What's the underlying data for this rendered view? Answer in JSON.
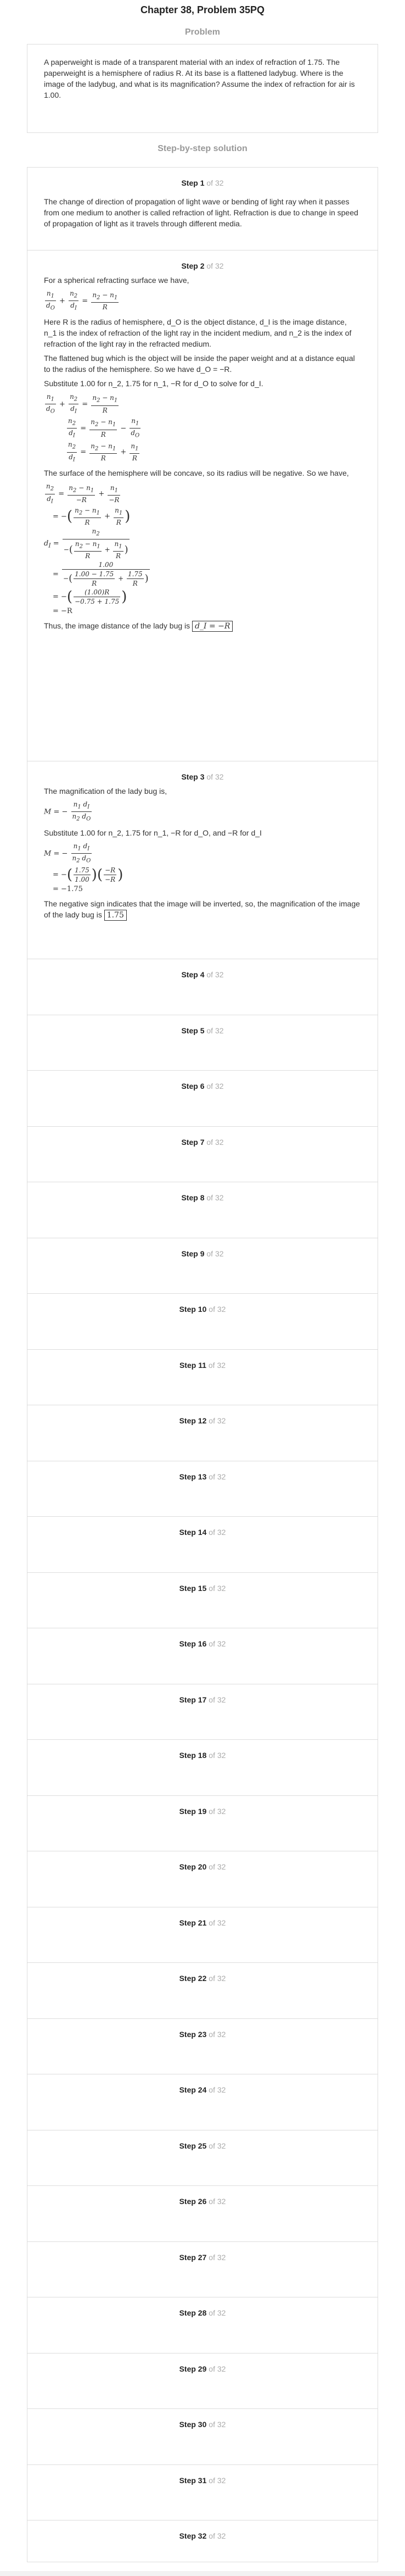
{
  "title": "Chapter 38, Problem 35PQ",
  "problem_heading": "Problem",
  "problem_text": "A paperweight is made of a transparent material with an index of refraction of 1.75. The paperweight is a hemisphere of radius R. At its base is a flattened ladybug. Where is the image of the ladybug, and what is its magnification? Assume the index of refraction for air is 1.00.",
  "solution_heading": "Step-by-step solution",
  "total_steps_label": "of 32",
  "steps": [
    {
      "label": "Step 1"
    },
    {
      "label": "Step 2"
    },
    {
      "label": "Step 3"
    },
    {
      "label": "Step 4"
    },
    {
      "label": "Step 5"
    },
    {
      "label": "Step 6"
    },
    {
      "label": "Step 7"
    },
    {
      "label": "Step 8"
    },
    {
      "label": "Step 9"
    },
    {
      "label": "Step 10"
    },
    {
      "label": "Step 11"
    },
    {
      "label": "Step 12"
    },
    {
      "label": "Step 13"
    },
    {
      "label": "Step 14"
    },
    {
      "label": "Step 15"
    },
    {
      "label": "Step 16"
    },
    {
      "label": "Step 17"
    },
    {
      "label": "Step 18"
    },
    {
      "label": "Step 19"
    },
    {
      "label": "Step 20"
    },
    {
      "label": "Step 21"
    },
    {
      "label": "Step 22"
    },
    {
      "label": "Step 23"
    },
    {
      "label": "Step 24"
    },
    {
      "label": "Step 25"
    },
    {
      "label": "Step 26"
    },
    {
      "label": "Step 27"
    },
    {
      "label": "Step 28"
    },
    {
      "label": "Step 29"
    },
    {
      "label": "Step 30"
    },
    {
      "label": "Step 31"
    },
    {
      "label": "Step 32"
    }
  ],
  "step1": {
    "text": "The change of direction of propagation of light wave or bending of light ray when it passes from one medium to another is called refraction of light. Refraction is due to change in speed of propagation of light as it travels through different media."
  },
  "step2": {
    "intro": "For a spherical refracting surface we have,",
    "here_text": "Here R is the radius of hemisphere, d_O is the object distance, d_I is the image distance, n_1 is the index of refraction of the light ray in the incident medium, and n_2 is the index of refraction of the light ray in the refracted medium.",
    "bug_text": "The flattened bug which is the object will be inside the paper weight and at a distance equal to the radius of the hemisphere. So we have d_O = −R.",
    "substitute_text": "Substitute 1.00 for n_2, 1.75 for n_1, −R for d_O to solve for d_I.",
    "concave_text": "The surface of the hemisphere will be concave, so its radius will be negative. So we have,",
    "result_text": "Thus, the image distance of the lady bug is",
    "result_value": "d_I = −R",
    "n1": "1.75",
    "n2": "1.00",
    "neg075": "−0.75 + 1.75",
    "numer": "(1.00)R"
  },
  "step3": {
    "intro": "The magnification of the lady bug is,",
    "substitute_text": "Substitute 1.00 for n_2, 1.75 for n_1, −R for d_O, and −R for d_I",
    "result_line": "= −1.75",
    "conclusion": "The negative sign indicates that the image will be inverted, so, the magnification of the image of the lady bug is",
    "conclusion_value": "1.75"
  }
}
